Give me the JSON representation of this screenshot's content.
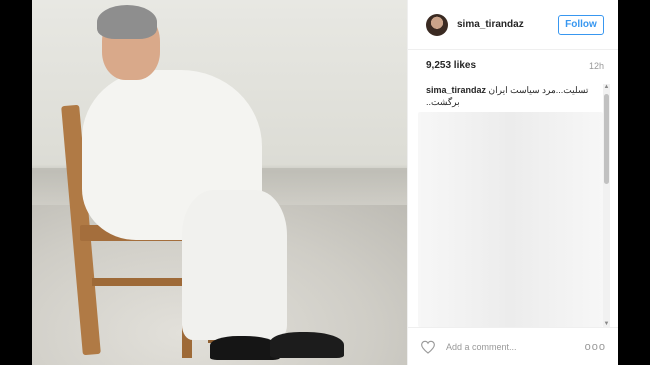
{
  "post": {
    "image": {
      "description_icon": "photo-icon"
    },
    "header": {
      "username": "sima_tirandaz",
      "follow_label": "Follow"
    },
    "meta": {
      "likes": "9,253 likes",
      "time": "12h"
    },
    "caption": {
      "username": "sima_tirandaz",
      "text": "تسلیت...مرد سیاست ایران برگشت.."
    },
    "footer": {
      "comment_placeholder": "Add a comment...",
      "more_label": "ooo"
    }
  },
  "colors": {
    "accent": "#3897f0",
    "text": "#262626",
    "muted": "#999999"
  }
}
